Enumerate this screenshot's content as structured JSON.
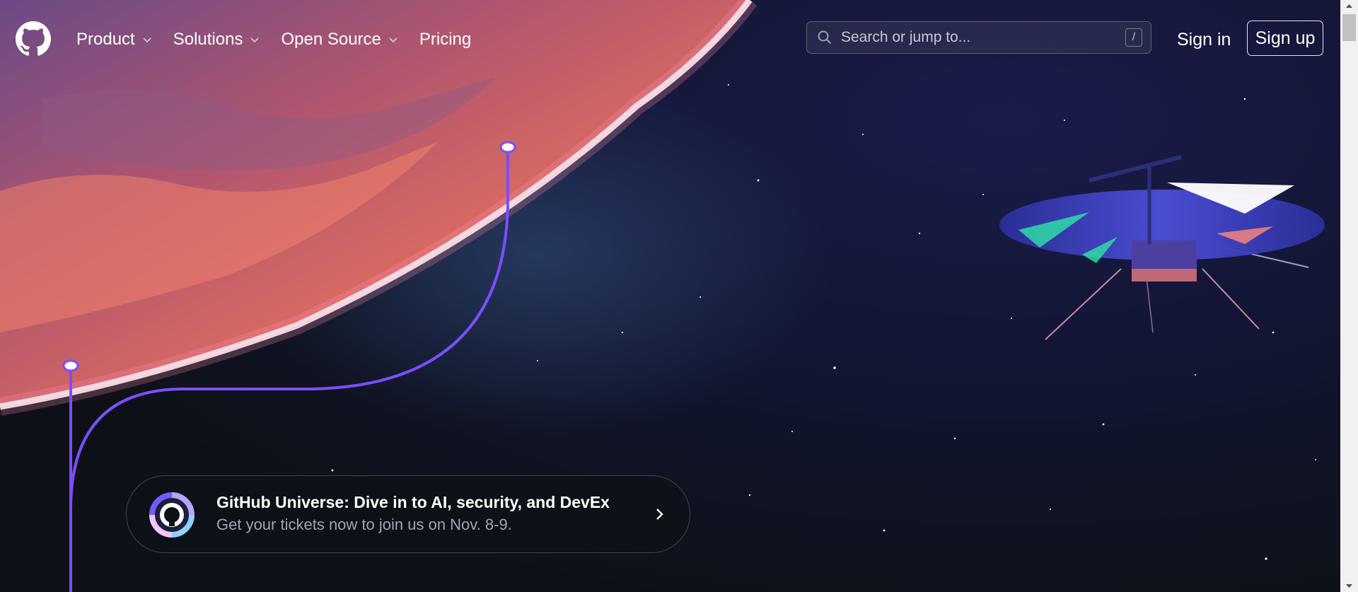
{
  "header": {
    "logo_icon": "github-mark-icon",
    "nav": [
      {
        "label": "Product",
        "has_dropdown": true
      },
      {
        "label": "Solutions",
        "has_dropdown": true
      },
      {
        "label": "Open Source",
        "has_dropdown": true
      },
      {
        "label": "Pricing",
        "has_dropdown": false
      }
    ],
    "search": {
      "placeholder": "Search or jump to...",
      "shortcut": "/"
    },
    "sign_in": "Sign in",
    "sign_up": "Sign up"
  },
  "banner": {
    "title": "GitHub Universe: Dive in to AI, security, and DevEx",
    "subtitle": "Get your tickets now to join us on Nov. 8-9.",
    "icon": "universe-octocat-icon",
    "arrow_icon": "chevron-right-icon"
  },
  "colors": {
    "background": "#0d1117",
    "accent_line": "#7c4dff",
    "planet": "#e86a57",
    "text_primary": "#ffffff",
    "text_secondary": "#9ea7b3"
  }
}
